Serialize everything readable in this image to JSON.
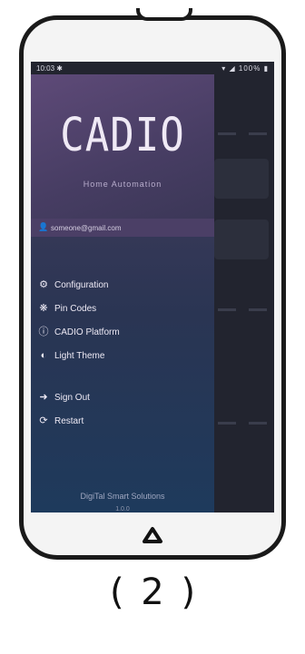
{
  "status_bar": {
    "time": "10:03 ✱",
    "icons": "▾ ◢ 100% ▮"
  },
  "drawer": {
    "brand_title": "CADIO",
    "brand_subtitle": "Home Automation",
    "account_email": "someone@gmail.com",
    "menu": [
      {
        "icon": "gear-icon",
        "glyph": "⚙",
        "label": "Configuration"
      },
      {
        "icon": "pin-icon",
        "glyph": "❋",
        "label": "Pin Codes"
      },
      {
        "icon": "info-icon",
        "glyph": "ⓘ",
        "label": "CADIO Platform"
      },
      {
        "icon": "theme-icon",
        "glyph": "◐",
        "label": "Light Theme"
      },
      {
        "icon": "sign-out-icon",
        "glyph": "➜",
        "label": "Sign Out"
      },
      {
        "icon": "restart-icon",
        "glyph": "⟳",
        "label": "Restart"
      }
    ],
    "footer": "DigiTal Smart Solutions",
    "version": "1.0.0"
  },
  "caption": "( 2 )"
}
